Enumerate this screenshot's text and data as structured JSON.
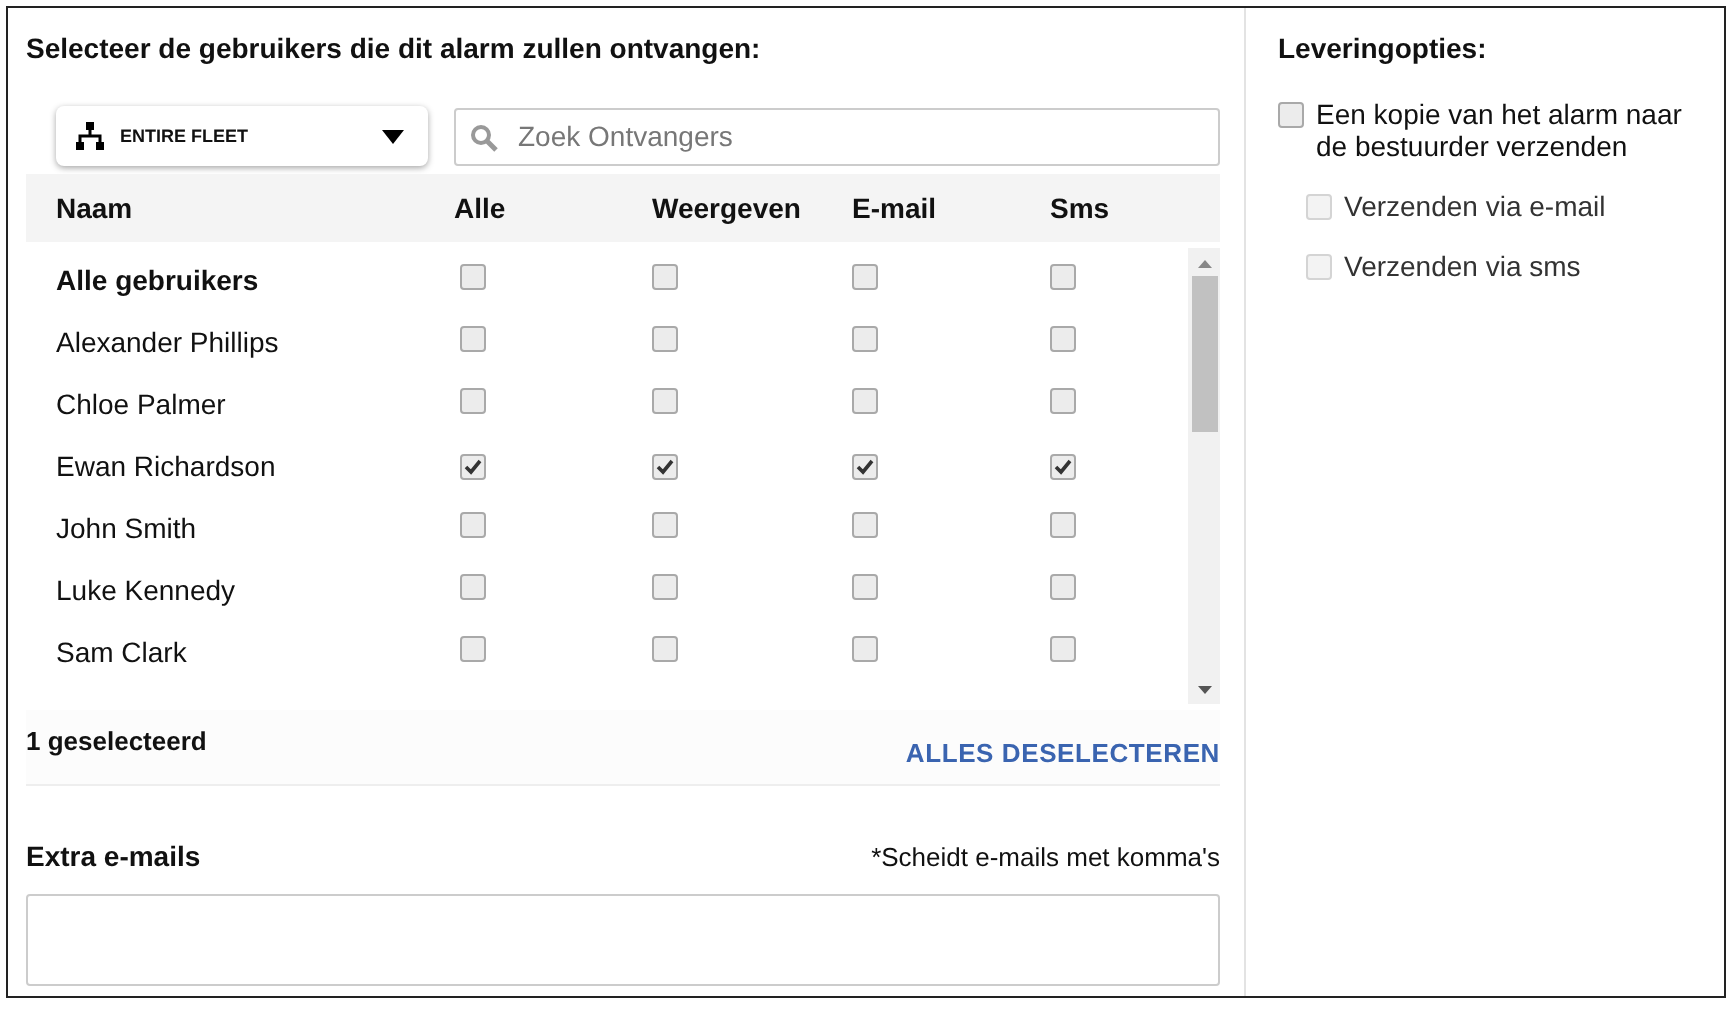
{
  "recipients": {
    "title": "Selecteer de gebruikers die dit alarm zullen ontvangen:",
    "fleet_dropdown": {
      "value": "ENTIRE FLEET"
    },
    "search": {
      "placeholder": "Zoek Ontvangers"
    },
    "table": {
      "columns": [
        "Naam",
        "Alle",
        "Weergeven",
        "E-mail",
        "Sms"
      ],
      "rows": [
        {
          "kind": "all",
          "name": "Alle gebruikers",
          "checks": [
            false,
            false,
            false,
            false
          ]
        },
        {
          "kind": "user",
          "name": "Alexander Phillips",
          "checks": [
            false,
            false,
            false,
            false
          ]
        },
        {
          "kind": "user",
          "name": "Chloe Palmer",
          "checks": [
            false,
            false,
            false,
            false
          ]
        },
        {
          "kind": "user",
          "name": "Ewan Richardson",
          "checks": [
            true,
            true,
            true,
            true
          ]
        },
        {
          "kind": "user",
          "name": "John Smith",
          "checks": [
            false,
            false,
            false,
            false
          ]
        },
        {
          "kind": "user",
          "name": "Luke Kennedy",
          "checks": [
            false,
            false,
            false,
            false
          ]
        },
        {
          "kind": "user",
          "name": "Sam Clark",
          "checks": [
            false,
            false,
            false,
            false
          ]
        }
      ]
    },
    "selected_count": "1 geselecteerd",
    "deselect_all": "ALLES DESELECTEREN",
    "extra_emails": {
      "label": "Extra e-mails",
      "hint": "*Scheidt e-mails met komma's"
    }
  },
  "delivery": {
    "title": "Leveringopties:",
    "options": [
      {
        "label": "Een kopie van het alarm naar de bestuurder verzenden",
        "checked": false,
        "disabled": false,
        "children": [
          {
            "label": "Verzenden via e-mail",
            "checked": false,
            "disabled": true
          },
          {
            "label": "Verzenden via sms",
            "checked": false,
            "disabled": true
          }
        ]
      }
    ]
  }
}
